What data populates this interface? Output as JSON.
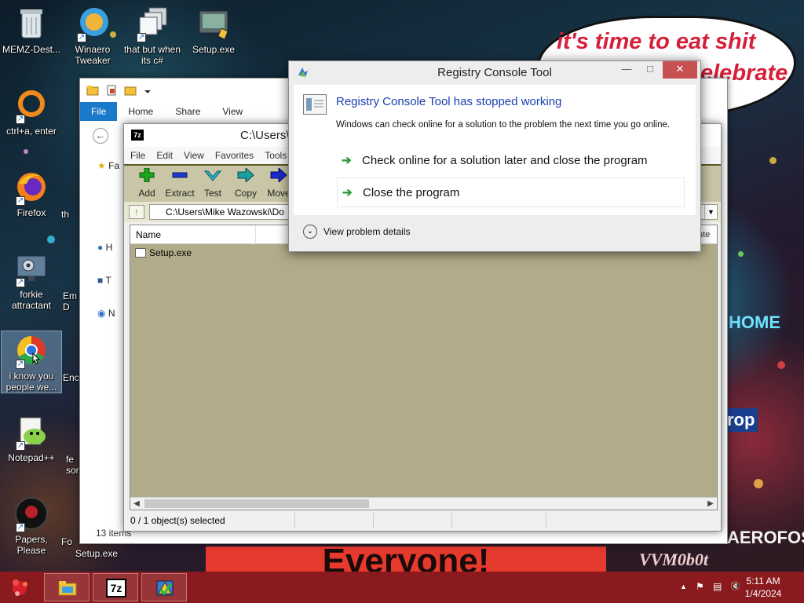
{
  "desktop": {
    "icons": [
      {
        "label": "MEMZ-Dest..."
      },
      {
        "label": "Winaero Tweaker"
      },
      {
        "label": "that but when its c#"
      },
      {
        "label": "Setup.exe"
      },
      {
        "label": "ctrl+a, enter"
      },
      {
        "label": "Firefox"
      },
      {
        "label": "forkie attractant"
      },
      {
        "label": "i know you people we..."
      },
      {
        "label": "Notepad++"
      },
      {
        "label": "Papers, Please"
      }
    ],
    "partial_labels": [
      "th",
      "Em",
      "D",
      "Enc",
      "fe",
      "sor",
      "Fo",
      "Setup.exe"
    ],
    "wallpaper": {
      "bubble_line1": "it's time to eat shit",
      "bubble_line2": "elebrate",
      "banner": "Everyone!",
      "watermark": "VVM0b0t",
      "neon_home": "HOME",
      "neon_2": "rop",
      "neon_3": "AEROFOS"
    }
  },
  "explorer": {
    "tabs": [
      "File",
      "Home",
      "Share",
      "View"
    ],
    "sidebar": [
      "Fa",
      "H",
      "T",
      "N"
    ],
    "status": "13 items"
  },
  "sevenzip": {
    "title": "C:\\Users\\",
    "menu": [
      "File",
      "Edit",
      "View",
      "Favorites",
      "Tools"
    ],
    "toolbar": [
      {
        "label": "Add",
        "icon": "plus-icon",
        "color": "#1aa51a"
      },
      {
        "label": "Extract",
        "icon": "minus-icon",
        "color": "#1a3ad0"
      },
      {
        "label": "Test",
        "icon": "check-icon",
        "color": "#2bb8c8"
      },
      {
        "label": "Copy",
        "icon": "arrow-right-icon",
        "color": "#1aa0a0"
      },
      {
        "label": "Move",
        "icon": "arrow-right-icon",
        "color": "#1a2ad0"
      }
    ],
    "address": "C:\\Users\\Mike Wazowski\\Do",
    "columns": {
      "name": "Name",
      "attr": "ute"
    },
    "files": [
      {
        "name": "Setup.exe"
      }
    ],
    "status": [
      "0 / 1 object(s) selected",
      "",
      "",
      ""
    ]
  },
  "dialog": {
    "title": "Registry Console Tool",
    "headline": "Registry Console Tool has stopped working",
    "description": "Windows can check online for a solution to the problem the next time you go online.",
    "options": [
      "Check online for a solution later and close the program",
      "Close the program"
    ],
    "details": "View problem details",
    "controls": {
      "minimize": "—",
      "maximize": "□",
      "close": "✕"
    }
  },
  "taskbar": {
    "clock_time": "5:11 AM",
    "clock_date": "1/4/2024",
    "tray": {
      "up_arrow": "▲",
      "flag": "⚑",
      "network": "▤",
      "volume": "🔇"
    },
    "buttons": [
      "file-explorer",
      "7-zip",
      "warning-app"
    ],
    "seven_zip_label": "7z",
    "accent": "#8a1a1e"
  }
}
